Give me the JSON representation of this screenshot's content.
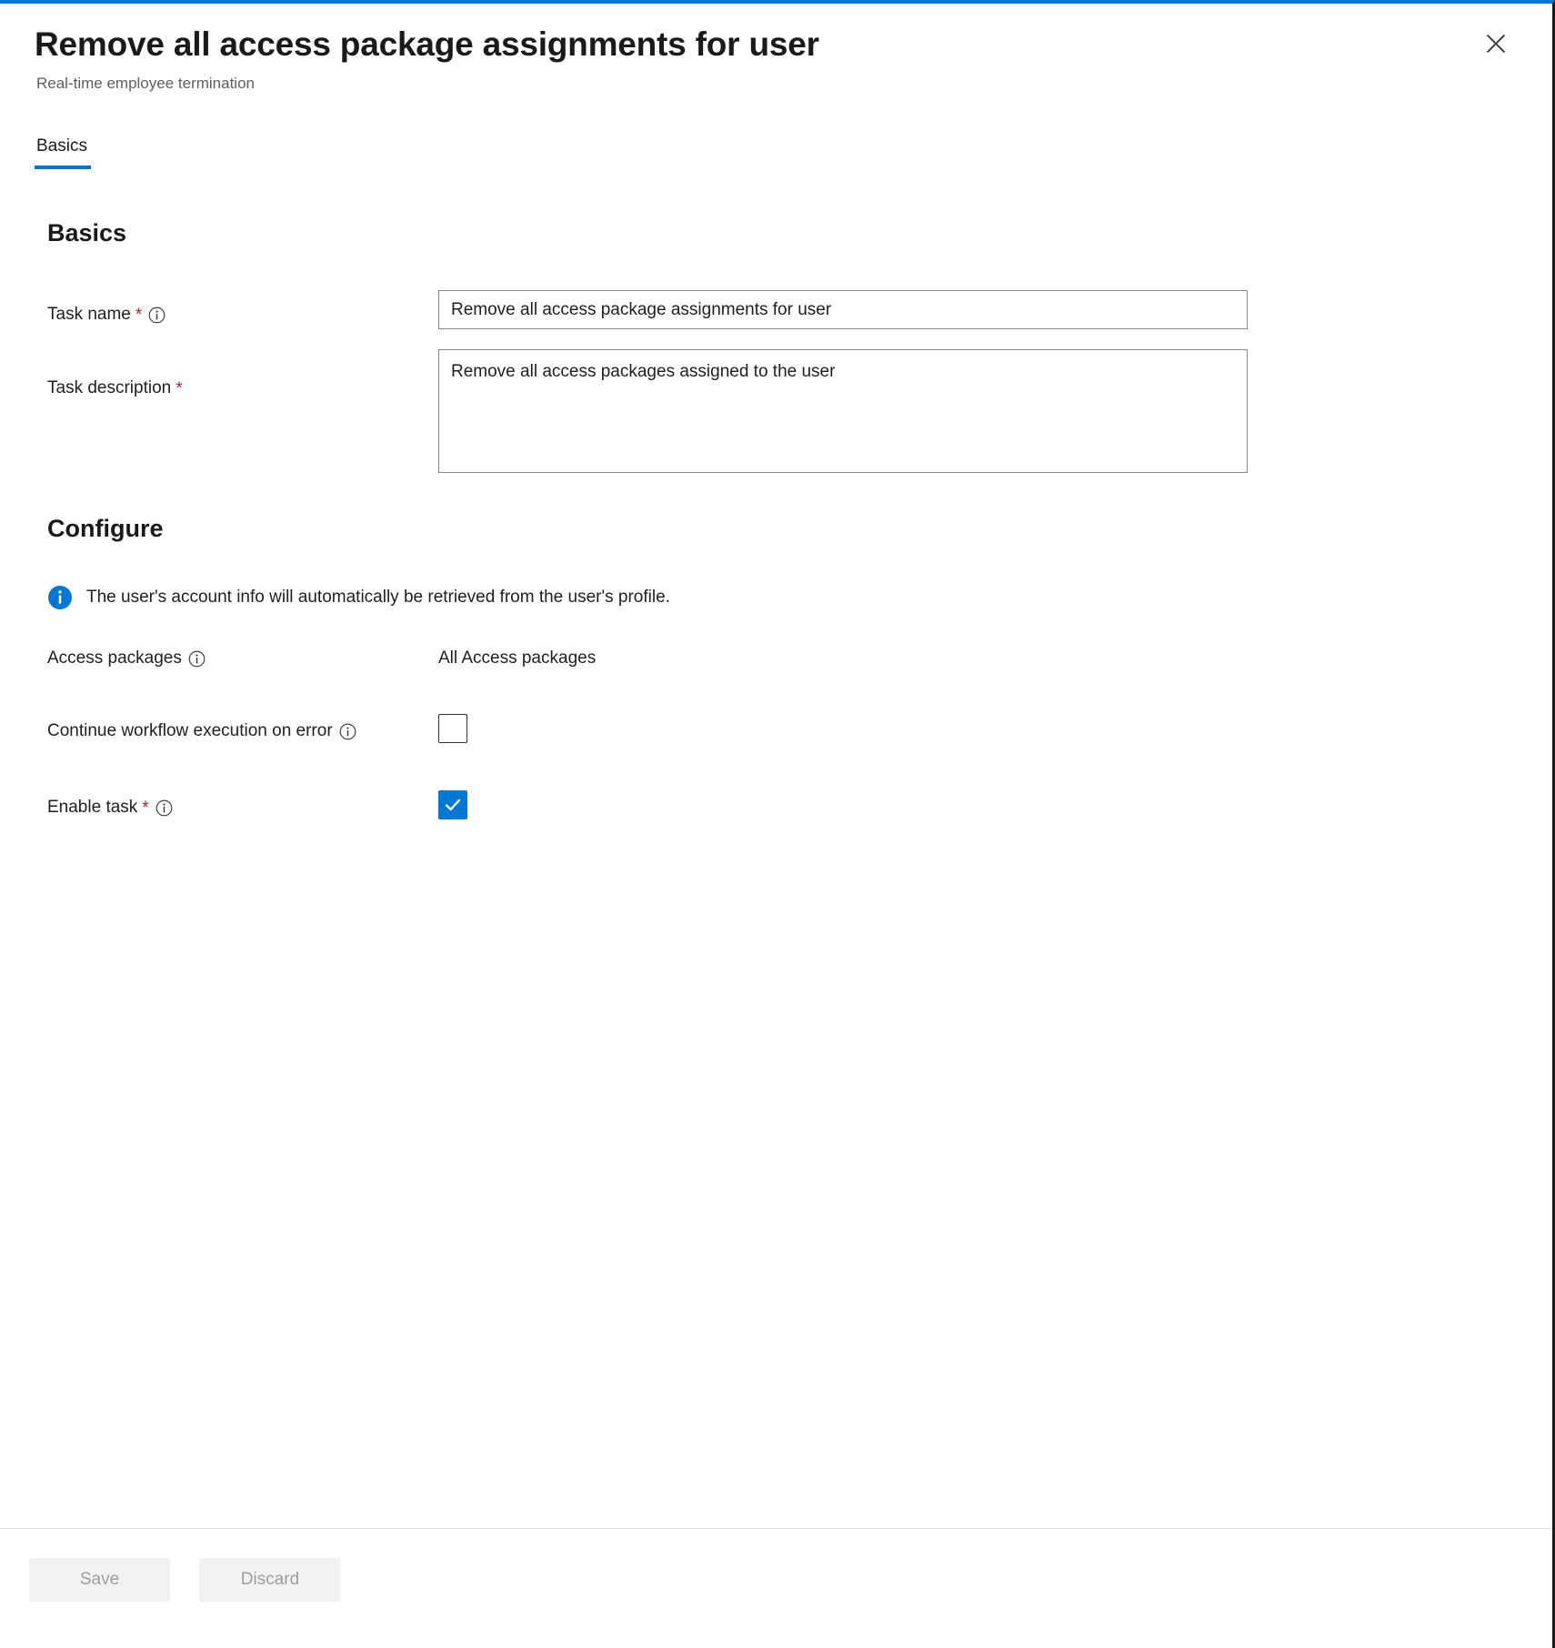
{
  "header": {
    "title": "Remove all access package assignments for user",
    "subtitle": "Real-time employee termination",
    "close_label": "Close"
  },
  "tabs": [
    {
      "label": "Basics",
      "active": true
    }
  ],
  "sections": {
    "basics": {
      "heading": "Basics",
      "task_name": {
        "label": "Task name",
        "required_marker": "*",
        "value": "Remove all access package assignments for user",
        "placeholder": "Task name"
      },
      "task_description": {
        "label": "Task description",
        "required_marker": "*",
        "value": "Remove all access packages assigned to the user",
        "placeholder": "Task description"
      }
    },
    "configure": {
      "heading": "Configure",
      "info_message": "The user's account info will automatically be retrieved from the user's profile.",
      "access_packages": {
        "label": "Access packages",
        "value": "All Access packages"
      },
      "continue_on_error": {
        "label": "Continue workflow execution on error",
        "checked": false
      },
      "enable_task": {
        "label": "Enable task",
        "required_marker": "*",
        "checked": true
      }
    }
  },
  "footer": {
    "save_label": "Save",
    "discard_label": "Discard"
  },
  "colors": {
    "accent": "#0078d4",
    "required": "#a4262c",
    "border": "#8a8886",
    "text": "#201f1e",
    "subtext": "#605e5c",
    "disabled_bg": "#f3f2f1",
    "disabled_text": "#a19f9d"
  }
}
